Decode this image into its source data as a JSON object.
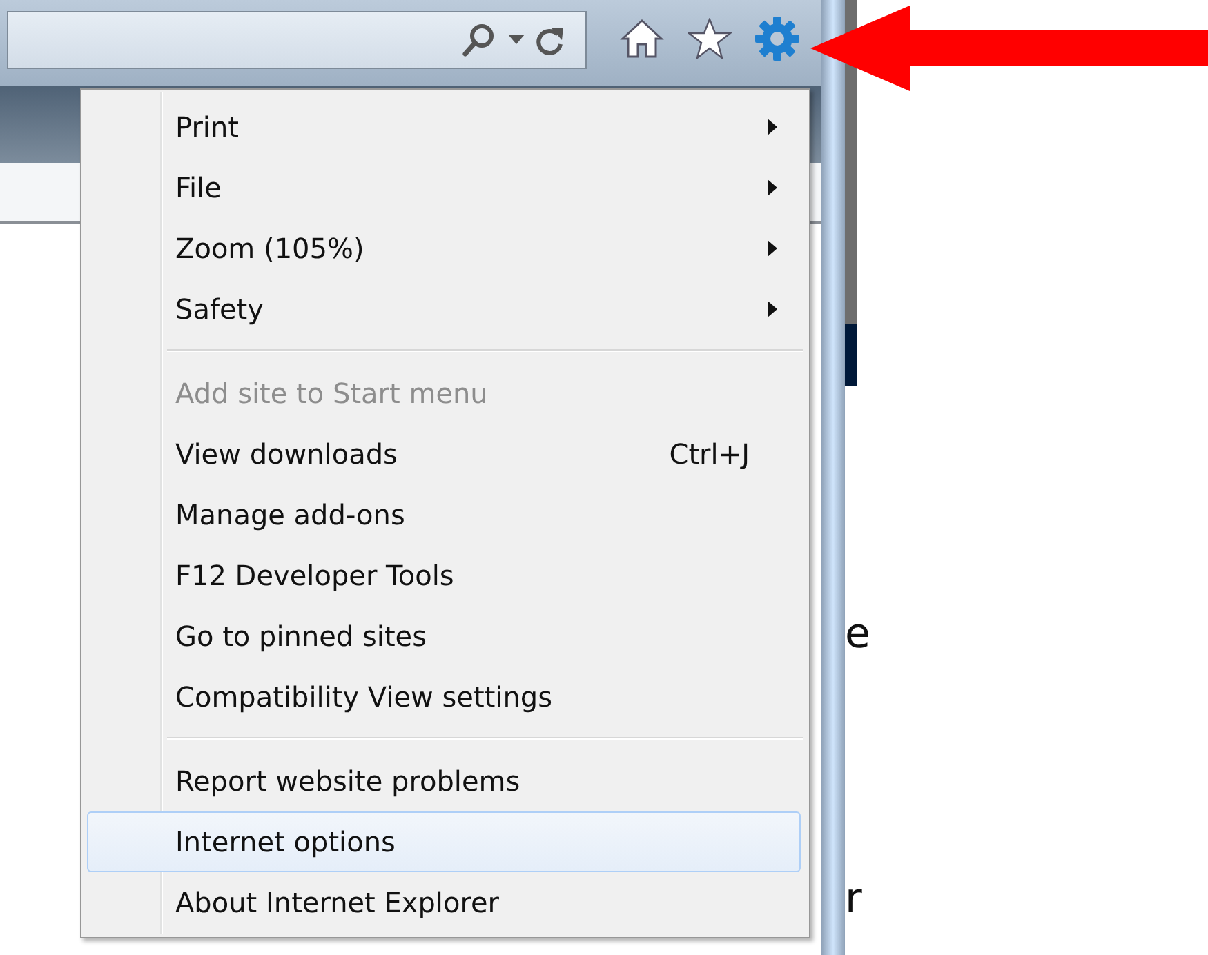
{
  "menu": {
    "sections": [
      [
        {
          "label": "Print",
          "submenu": true,
          "disabled": false,
          "selected": false
        },
        {
          "label": "File",
          "submenu": true,
          "disabled": false,
          "selected": false
        },
        {
          "label": "Zoom (105%)",
          "submenu": true,
          "disabled": false,
          "selected": false
        },
        {
          "label": "Safety",
          "submenu": true,
          "disabled": false,
          "selected": false
        }
      ],
      [
        {
          "label": "Add site to Start menu",
          "submenu": false,
          "disabled": true,
          "selected": false
        },
        {
          "label": "View downloads",
          "shortcut": "Ctrl+J",
          "submenu": false,
          "disabled": false,
          "selected": false
        },
        {
          "label": "Manage add-ons",
          "submenu": false,
          "disabled": false,
          "selected": false
        },
        {
          "label": "F12 Developer Tools",
          "submenu": false,
          "disabled": false,
          "selected": false
        },
        {
          "label": "Go to pinned sites",
          "submenu": false,
          "disabled": false,
          "selected": false
        },
        {
          "label": "Compatibility View settings",
          "submenu": false,
          "disabled": false,
          "selected": false
        }
      ],
      [
        {
          "label": "Report website problems",
          "submenu": false,
          "disabled": false,
          "selected": false
        },
        {
          "label": "Internet options",
          "submenu": false,
          "disabled": false,
          "selected": true
        },
        {
          "label": "About Internet Explorer",
          "submenu": false,
          "disabled": false,
          "selected": false
        }
      ]
    ]
  },
  "page_text": [
    "e",
    "r"
  ]
}
